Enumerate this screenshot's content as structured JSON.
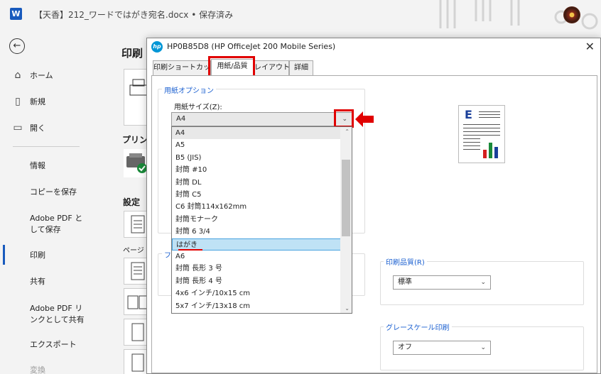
{
  "app": {
    "title": "【天香】212_ワードではがき宛名.docx • 保存済み",
    "logo_letter": "W",
    "back_glyph": "←"
  },
  "nav": {
    "items": [
      {
        "label": "ホーム",
        "icon": "home-icon",
        "glyph": "⌂"
      },
      {
        "label": "新規",
        "icon": "new-document-icon",
        "glyph": "▯"
      },
      {
        "label": "開く",
        "icon": "folder-icon",
        "glyph": "▭"
      }
    ],
    "sub_items": [
      {
        "label": "情報"
      },
      {
        "label": "コピーを保存"
      },
      {
        "label_line1": "Adobe PDF と",
        "label_line2": "して保存"
      },
      {
        "label": "印刷",
        "active": true
      },
      {
        "label": "共有"
      },
      {
        "label_line1": "Adobe PDF リ",
        "label_line2": "ンクとして共有"
      },
      {
        "label": "エクスポート"
      },
      {
        "label": "変換"
      }
    ]
  },
  "backstage": {
    "heading": "印刷",
    "printer_heading": "プリン",
    "settings_heading": "設定",
    "page_label": "ページ"
  },
  "dialog": {
    "title": "HP0B85D8 (HP OfficeJet 200 Mobile Series)",
    "close_glyph": "✕",
    "hp_logo_text": "hp",
    "tabs": [
      {
        "label": "印刷ショートカット"
      },
      {
        "label": "用紙/品質",
        "active": true
      },
      {
        "label": "レイアウト"
      },
      {
        "label": "詳細"
      }
    ],
    "paper_options": {
      "group_label": "用紙オプション",
      "paper_size_label": "用紙サイズ(Z):",
      "paper_size_value": "A4",
      "paper_sizes": [
        "A4",
        "A5",
        "B5 (JIS)",
        "封筒 #10",
        "封筒 DL",
        "封筒 C5",
        "C6 封筒114x162mm",
        "封筒モナーク",
        "封筒 6 3/4",
        "はがき",
        "A6",
        "封筒 長形 3 号",
        "封筒 長形 4 号",
        "4x6 インチ/10x15 cm",
        "5x7 インチ/13x18 cm"
      ],
      "selected_index": 9
    },
    "second_group_label_fragment": "フ",
    "print_quality": {
      "label": "印刷品質(R)",
      "value": "標準"
    },
    "grayscale": {
      "label": "グレースケール印刷",
      "value": "オフ"
    },
    "preview": {
      "letter": "E",
      "bar_colors": [
        "#d42020",
        "#1a8a3a",
        "#1a3f9a"
      ]
    }
  },
  "colors": {
    "accent": "#185abd",
    "annotation_red": "#e00000",
    "group_legend_blue": "#1a5fd0",
    "selection": "#bfe2f5"
  }
}
